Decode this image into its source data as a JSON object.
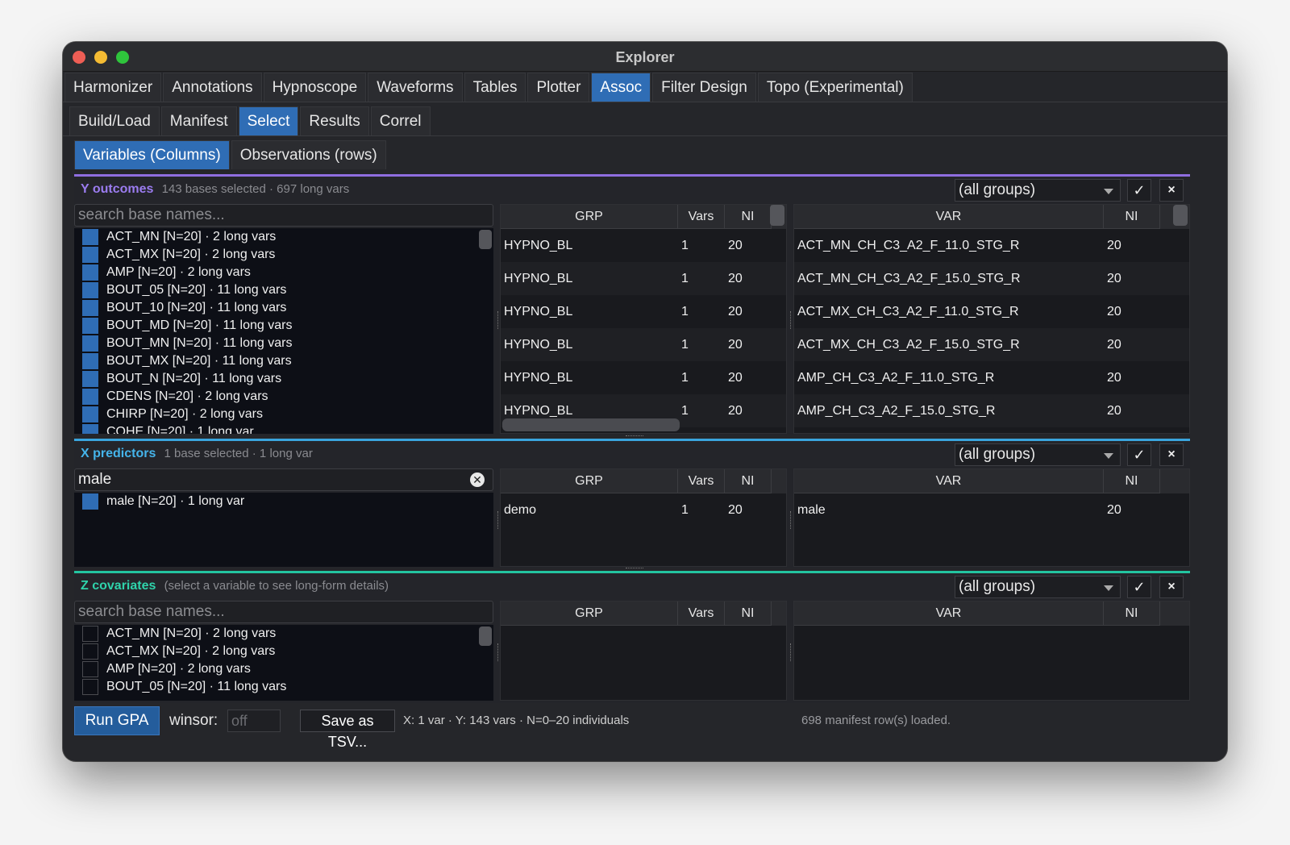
{
  "window": {
    "title": "Explorer"
  },
  "tabs_main": [
    "Harmonizer",
    "Annotations",
    "Hypnoscope",
    "Waveforms",
    "Tables",
    "Plotter",
    "Assoc",
    "Filter Design",
    "Topo (Experimental)"
  ],
  "tabs_sub": [
    "Build/Load",
    "Manifest",
    "Select",
    "Results",
    "Correl"
  ],
  "tabs_sel": [
    "Variables (Columns)",
    "Observations (rows)"
  ],
  "active": {
    "main": "Assoc",
    "sub": "Select",
    "sel": "Variables (Columns)"
  },
  "colors": {
    "accent": "#2f6db5",
    "y_rule": "#8f6ee0",
    "y_title": "#9b7cf0",
    "x_rule": "#3aa5dd",
    "x_title": "#45b4ea",
    "z_rule": "#23c4a0",
    "z_title": "#2fd3ab"
  },
  "icons": {
    "check": "✓",
    "close": "×",
    "clear": "✕"
  },
  "y": {
    "name": "Y outcomes",
    "info": "143 bases selected  ·  697 long vars",
    "group_select": "(all groups)",
    "search_placeholder": "search base names...",
    "list": [
      "ACT_MN  [N=20]  ·  2 long vars",
      "ACT_MX  [N=20]  ·  2 long vars",
      "AMP  [N=20]  ·  2 long vars",
      "BOUT_05  [N=20]  ·  11 long vars",
      "BOUT_10  [N=20]  ·  11 long vars",
      "BOUT_MD  [N=20]  ·  11 long vars",
      "BOUT_MN  [N=20]  ·  11 long vars",
      "BOUT_MX  [N=20]  ·  11 long vars",
      "BOUT_N  [N=20]  ·  11 long vars",
      "CDENS  [N=20]  ·  2 long vars",
      "CHIRP  [N=20]  ·  2 long vars",
      "COHE  [N=20]  ·  1 long var"
    ],
    "grp_headers": [
      "GRP",
      "Vars",
      "NI"
    ],
    "grp_rows": [
      [
        "HYPNO_BL",
        "1",
        "20"
      ],
      [
        "HYPNO_BL",
        "1",
        "20"
      ],
      [
        "HYPNO_BL",
        "1",
        "20"
      ],
      [
        "HYPNO_BL",
        "1",
        "20"
      ],
      [
        "HYPNO_BL",
        "1",
        "20"
      ],
      [
        "HYPNO_BL",
        "1",
        "20"
      ]
    ],
    "var_headers": [
      "VAR",
      "NI"
    ],
    "var_rows": [
      [
        "ACT_MN_CH_C3_A2_F_11.0_STG_R",
        "20"
      ],
      [
        "ACT_MN_CH_C3_A2_F_15.0_STG_R",
        "20"
      ],
      [
        "ACT_MX_CH_C3_A2_F_11.0_STG_R",
        "20"
      ],
      [
        "ACT_MX_CH_C3_A2_F_15.0_STG_R",
        "20"
      ],
      [
        "AMP_CH_C3_A2_F_11.0_STG_R",
        "20"
      ],
      [
        "AMP_CH_C3_A2_F_15.0_STG_R",
        "20"
      ]
    ]
  },
  "x": {
    "name": "X predictors",
    "info": "1 base selected  ·  1 long var",
    "group_select": "(all groups)",
    "search_value": "male",
    "list": [
      "male  [N=20]  ·  1 long var"
    ],
    "grp_headers": [
      "GRP",
      "Vars",
      "NI"
    ],
    "grp_rows": [
      [
        "demo",
        "1",
        "20"
      ]
    ],
    "var_headers": [
      "VAR",
      "NI"
    ],
    "var_rows": [
      [
        "male",
        "20"
      ]
    ]
  },
  "z": {
    "name": "Z covariates",
    "info": "(select a variable to see long-form details)",
    "group_select": "(all groups)",
    "search_placeholder": "search base names...",
    "list": [
      "ACT_MN  [N=20]  ·  2 long vars",
      "ACT_MX  [N=20]  ·  2 long vars",
      "AMP  [N=20]  ·  2 long vars",
      "BOUT_05  [N=20]  ·  11 long vars"
    ],
    "grp_headers": [
      "GRP",
      "Vars",
      "NI"
    ],
    "var_headers": [
      "VAR",
      "NI"
    ]
  },
  "bottom": {
    "run_label": "Run GPA",
    "winsor_label": "winsor:",
    "winsor_placeholder": "off",
    "save_label": "Save as TSV...",
    "status": "X: 1 var  ·  Y: 143 vars  ·  N=0–20 individuals",
    "manifest": "698 manifest row(s) loaded."
  }
}
